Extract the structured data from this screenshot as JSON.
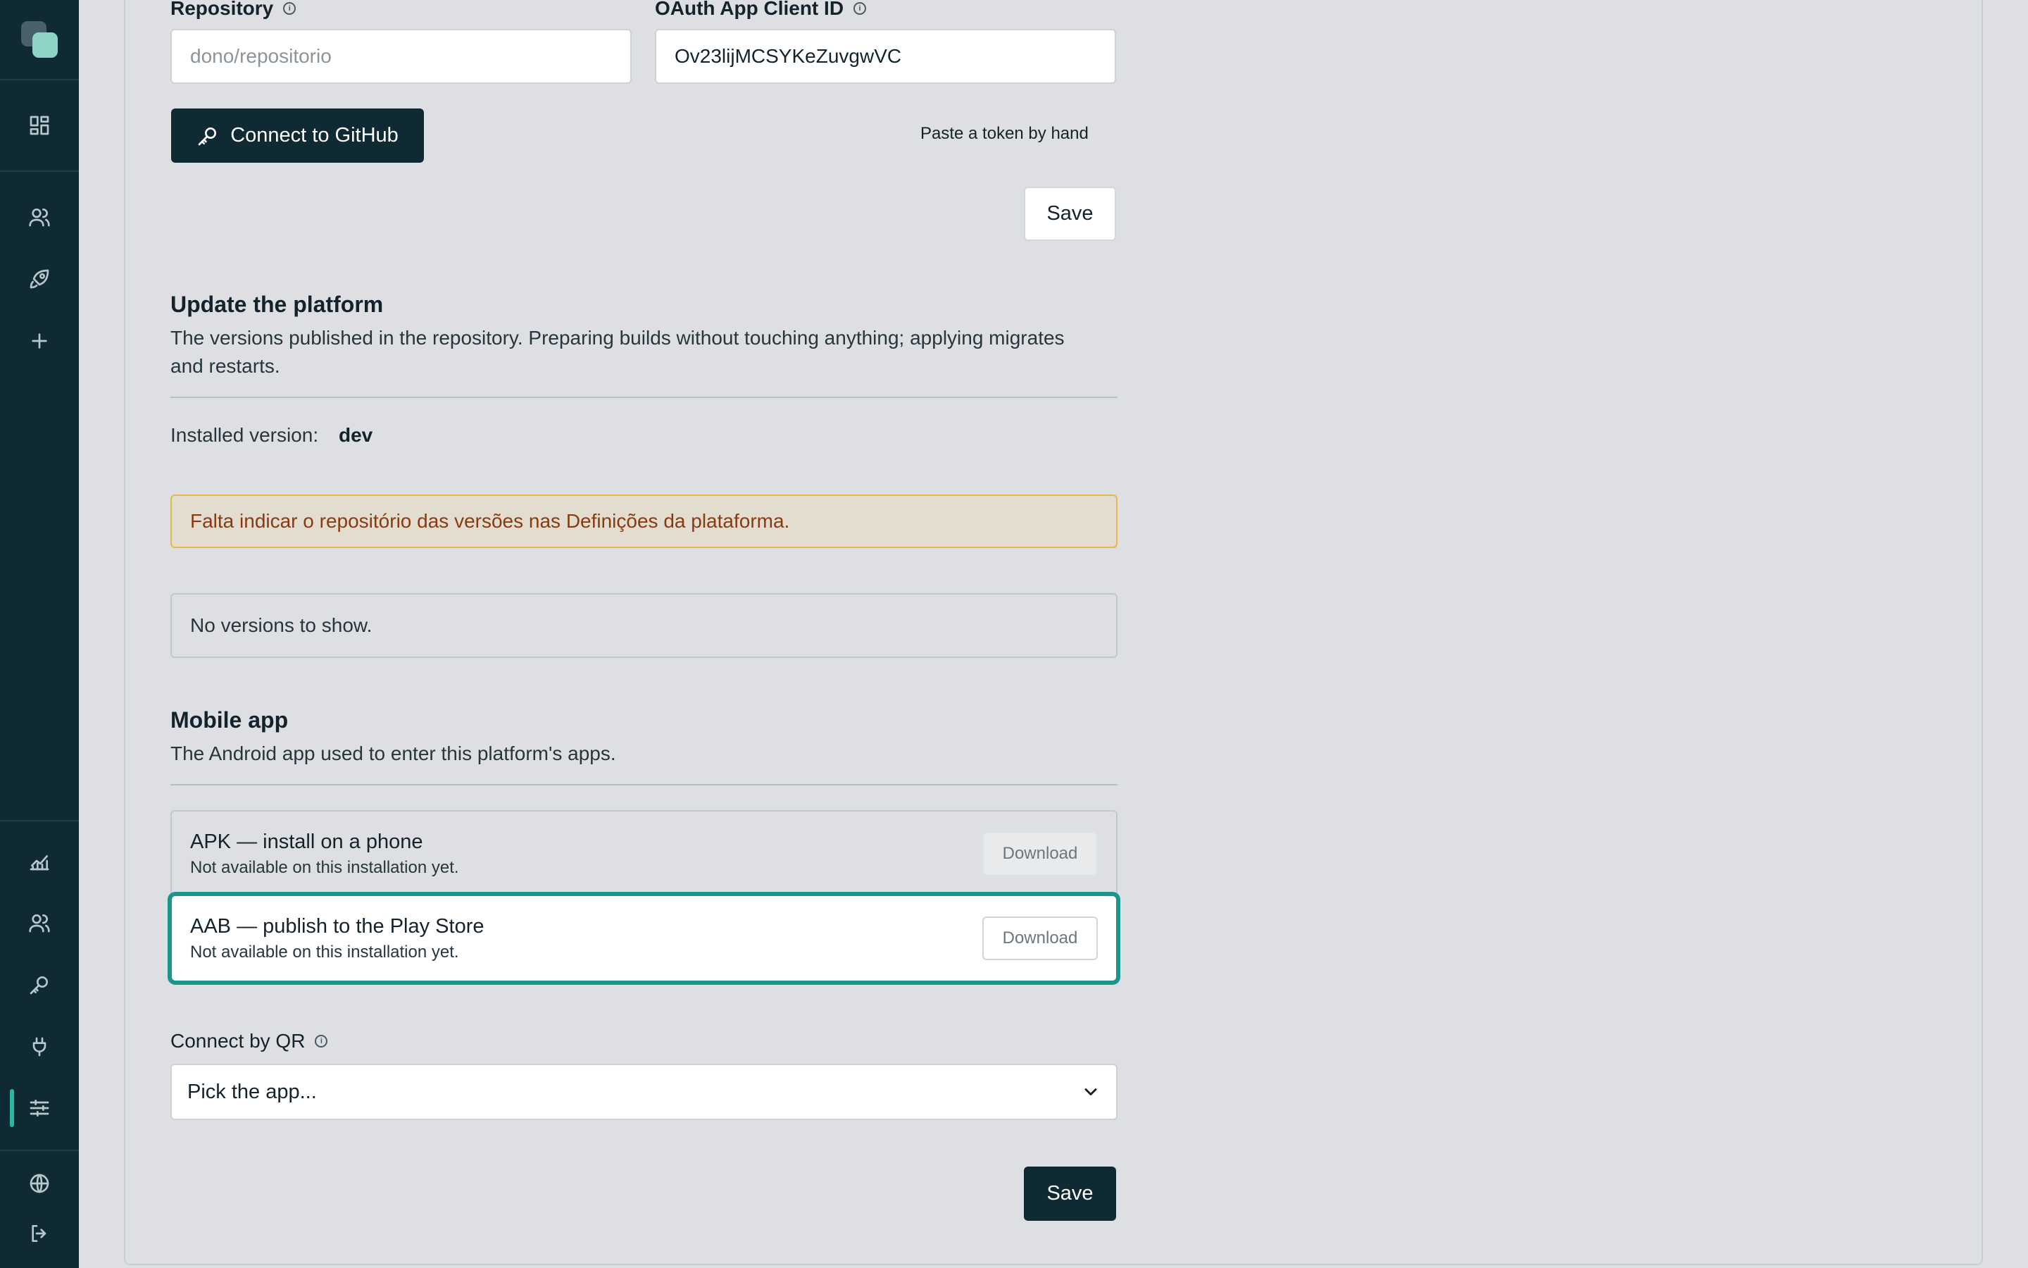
{
  "sidebar": {
    "icons": [
      "dashboard-icon",
      "users-icon",
      "rocket-icon",
      "plus-icon",
      "chart-icon",
      "team-icon",
      "key-icon",
      "plug-icon",
      "sliders-icon",
      "globe-icon",
      "logout-icon"
    ],
    "active": "sliders-icon"
  },
  "repo": {
    "repository_label": "Repository",
    "repository_placeholder": "dono/repositorio",
    "client_id_label": "OAuth App Client ID",
    "client_id_value": "Ov23lijMCSYKeZuvgwVC",
    "connect_label": "Connect to GitHub",
    "paste_token_label": "Paste a token by hand",
    "save_label": "Save"
  },
  "update": {
    "title": "Update the platform",
    "description": "The versions published in the repository. Preparing builds without touching anything; applying migrates and restarts.",
    "installed_label": "Installed version:",
    "installed_value": "dev",
    "warning": "Falta indicar o repositório das versões nas Definições da plataforma.",
    "empty_text": "No versions to show."
  },
  "mobile": {
    "title": "Mobile app",
    "description": "The Android app used to enter this platform's apps.",
    "apk": {
      "title": "APK — install on a phone",
      "subtitle": "Not available on this installation yet.",
      "button": "Download"
    },
    "aab": {
      "title": "AAB — publish to the Play Store",
      "subtitle": "Not available on this installation yet.",
      "button": "Download"
    },
    "qr_label": "Connect by QR",
    "qr_selected": "Pick the app...",
    "save_label": "Save"
  },
  "colors": {
    "sidebar_bg": "#102a33",
    "accent": "#1c958a",
    "warning_border": "#e6b84a",
    "warning_text": "#8a3a10"
  }
}
